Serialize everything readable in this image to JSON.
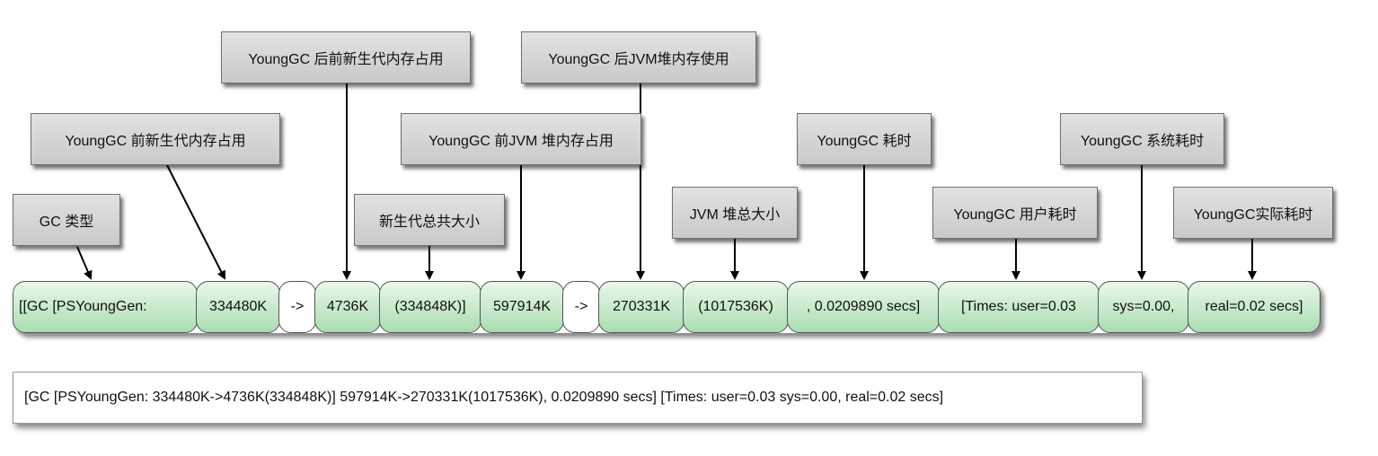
{
  "labels": {
    "young_gc_after_young_usage": "YoungGC 后前新生代内存占用",
    "young_gc_after_heap_usage": "YoungGC 后JVM堆内存使用",
    "young_gc_before_young_usage": "YoungGC 前新生代内存占用",
    "young_gc_before_heap_usage": "YoungGC 前JVM 堆内存占用",
    "young_gc_time": "YoungGC 耗时",
    "young_gc_sys_time": "YoungGC 系统耗时",
    "gc_type": "GC 类型",
    "young_gen_total_size": "新生代总共大小",
    "jvm_heap_total_size": "JVM 堆总大小",
    "young_gc_user_time": "YoungGC 用户耗时",
    "young_gc_real_time": "YoungGC实际耗时"
  },
  "segments": {
    "gc_prefix": "[[GC [PSYoungGen:",
    "young_before": "334480K",
    "arrow_1": "->",
    "young_after": "4736K",
    "young_total": "(334848K)]",
    "heap_before": "597914K",
    "arrow_2": "->",
    "heap_after": "270331K",
    "heap_total": "(1017536K)",
    "gc_secs": ", 0.0209890 secs]",
    "times_user": "[Times: user=0.03",
    "times_sys": "sys=0.00,",
    "times_real": "real=0.02 secs]"
  },
  "summary_line": "[GC [PSYoungGen: 334480K->4736K(334848K)] 597914K->270331K(1017536K), 0.0209890 secs] [Times: user=0.03 sys=0.00, real=0.02 secs]"
}
